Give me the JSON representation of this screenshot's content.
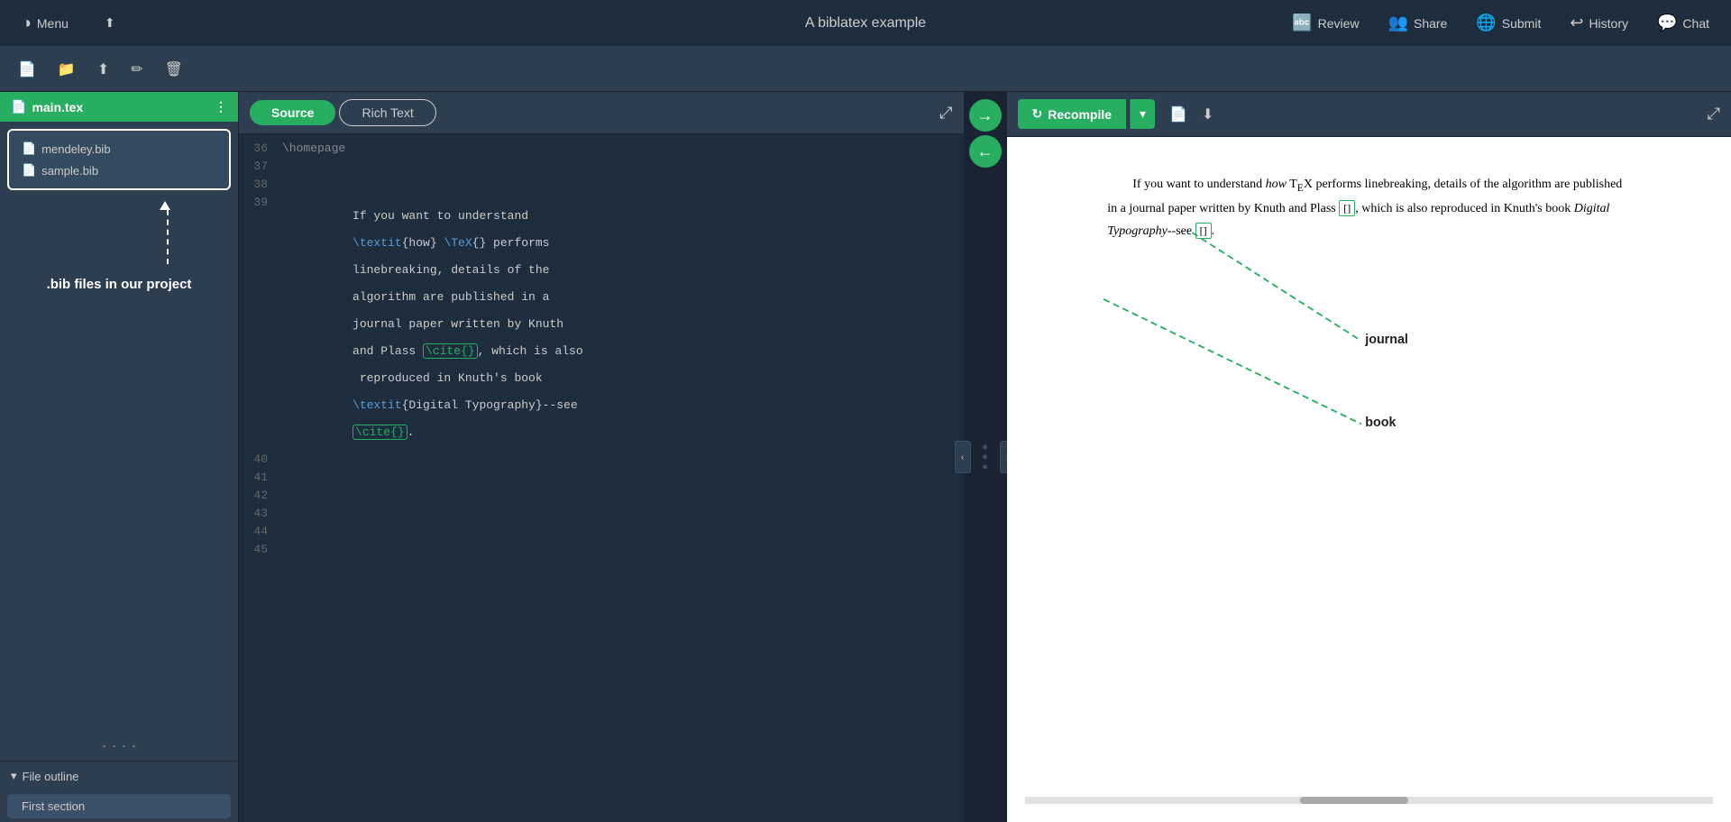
{
  "app": {
    "title": "A biblatex example",
    "logo": "◑",
    "menu_label": "Menu"
  },
  "navbar": {
    "review_label": "Review",
    "share_label": "Share",
    "submit_label": "Submit",
    "history_label": "History",
    "chat_label": "Chat"
  },
  "toolbar": {
    "new_file_icon": "📄",
    "open_folder_icon": "📁",
    "upload_icon": "⬆",
    "edit_icon": "✏",
    "delete_icon": "🗑"
  },
  "sidebar": {
    "main_file": "main.tex",
    "files": [
      {
        "name": "mendeley.bib",
        "icon": "📄"
      },
      {
        "name": "sample.bib",
        "icon": "📄"
      }
    ],
    "bib_label": ".bib files in our project",
    "file_outline_label": "File outline",
    "outline_items": [
      {
        "name": "First section"
      }
    ]
  },
  "editor": {
    "source_tab": "Source",
    "richtext_tab": "Rich Text",
    "lines": [
      {
        "num": "36",
        "content": ""
      },
      {
        "num": "37",
        "content": ""
      },
      {
        "num": "38",
        "content": ""
      },
      {
        "num": "39",
        "content_parts": [
          {
            "text": "If you want to understand\n",
            "type": "normal"
          },
          {
            "text": "\\textit",
            "type": "keyword"
          },
          {
            "text": "{how} ",
            "type": "normal"
          },
          {
            "text": "\\TeX",
            "type": "keyword"
          },
          {
            "text": "{} performs\nlinebreaking, details of the\nalgorithm are published in a\njournal paper written by Knuth\nand Plass ",
            "type": "normal"
          },
          {
            "text": "\\cite{}",
            "type": "cite"
          },
          {
            "text": ", which is also\n reproduced in Knuth's book\n",
            "type": "normal"
          },
          {
            "text": "\\textit",
            "type": "keyword"
          },
          {
            "text": "{Digital Typography}--see\n",
            "type": "normal"
          },
          {
            "text": "\\cite{}",
            "type": "cite"
          },
          {
            "text": ".",
            "type": "normal"
          }
        ]
      },
      {
        "num": "40",
        "content": ""
      },
      {
        "num": "41",
        "content": ""
      },
      {
        "num": "42",
        "content": ""
      },
      {
        "num": "43",
        "content": ""
      },
      {
        "num": "44",
        "content": ""
      },
      {
        "num": "45",
        "content": ""
      }
    ]
  },
  "recompile": {
    "button_label": "Recompile",
    "icon": "↻"
  },
  "preview": {
    "text": "If you want to understand how TeX performs linebreaking, details of the algorithm are published in a journal paper written by Knuth and Plass [], which is also reproduced in Knuth's book Digital Typography--see []."
  },
  "annotations": {
    "journal_label": "journal",
    "book_label": "book"
  }
}
